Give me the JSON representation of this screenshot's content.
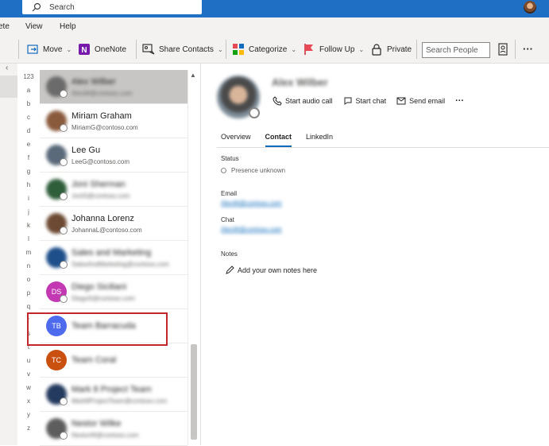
{
  "titlebar": {
    "search_placeholder": "Search"
  },
  "menubar": {
    "items": [
      "ete",
      "View",
      "Help"
    ]
  },
  "ribbon": {
    "move": "Move",
    "onenote": "OneNote",
    "share_contacts": "Share Contacts",
    "categorize": "Categorize",
    "follow_up": "Follow Up",
    "private": "Private",
    "search_people_placeholder": "Search People",
    "more": "···"
  },
  "index_letters": [
    "123",
    "a",
    "b",
    "c",
    "d",
    "e",
    "f",
    "g",
    "h",
    "i",
    "j",
    "k",
    "l",
    "m",
    "n",
    "o",
    "p",
    "q",
    "r",
    "s",
    "t",
    "u",
    "v",
    "w",
    "x",
    "y",
    "z"
  ],
  "contacts": [
    {
      "name": "Alex Wilber",
      "email": "AlexW@contoso.com",
      "initials": "",
      "color": "#6b6b6b",
      "selected": true,
      "blurred": true
    },
    {
      "name": "Miriam Graham",
      "email": "MiriamG@contoso.com",
      "initials": "",
      "color": "#8a5a3c",
      "selected": false,
      "blurred": false
    },
    {
      "name": "Lee Gu",
      "email": "LeeG@contoso.com",
      "initials": "",
      "color": "#5a6a7a",
      "selected": false,
      "blurred": false
    },
    {
      "name": "Joni Sherman",
      "email": "JoniS@contoso.com",
      "initials": "",
      "color": "#2f5e3b",
      "selected": false,
      "blurred": true
    },
    {
      "name": "Johanna Lorenz",
      "email": "JohannaL@contoso.com",
      "initials": "",
      "color": "#6d4a33",
      "selected": false,
      "blurred": false
    },
    {
      "name": "Sales and Marketing",
      "email": "SalesAndMarketing@contoso.com",
      "initials": "",
      "color": "#1e4f8a",
      "selected": false,
      "blurred": true
    },
    {
      "name": "Diego Siciliani",
      "email": "DiegoS@contoso.com",
      "initials": "DS",
      "color": "#c239b3",
      "selected": false,
      "blurred": true
    },
    {
      "name": "Team Barracuda",
      "email": "",
      "initials": "TB",
      "color": "#4f6bed",
      "selected": false,
      "blurred": true
    },
    {
      "name": "Team Coral",
      "email": "",
      "initials": "TC",
      "color": "#ca5010",
      "selected": false,
      "blurred": true
    },
    {
      "name": "Mark 8 Project Team",
      "email": "Mark8ProjectTeam@contoso.com",
      "initials": "",
      "color": "#243a5e",
      "selected": false,
      "blurred": true
    },
    {
      "name": "Nestor Wilke",
      "email": "NestorW@contoso.com",
      "initials": "",
      "color": "#5d5d5d",
      "selected": false,
      "blurred": true
    }
  ],
  "detail": {
    "name": "Alex Wilber",
    "actions": {
      "audio_call": "Start audio call",
      "chat": "Start chat",
      "email": "Send email",
      "more": "···"
    },
    "tabs": [
      "Overview",
      "Contact",
      "LinkedIn"
    ],
    "active_tab": "Contact",
    "status_label": "Status",
    "status_value": "Presence unknown",
    "email_label": "Email",
    "email_value": "AlexW@contoso.com",
    "chat_label": "Chat",
    "chat_value": "AlexW@contoso.com",
    "notes_label": "Notes",
    "notes_add": "Add your own notes here"
  },
  "colors": {
    "brand": "#1f6fc5",
    "highlight_box": "#c4262e",
    "link": "#0f6cbd"
  }
}
